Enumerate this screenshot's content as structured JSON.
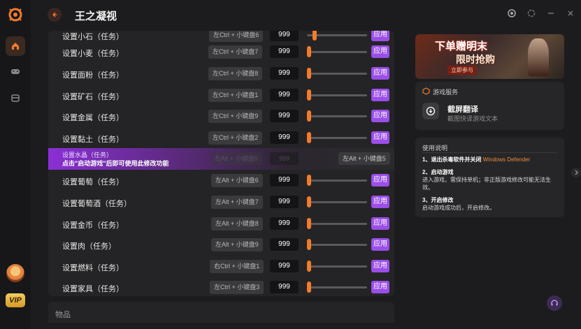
{
  "app": {
    "title": "王之凝视"
  },
  "rail": {
    "vip_label": "VIP"
  },
  "rows_cut": [
    {
      "label": "设置小石（任务）",
      "hotkey": "左Ctrl + 小键盘6",
      "value": "999",
      "apply": "应用"
    }
  ],
  "rows_top": [
    {
      "label": "设置小麦（任务）",
      "hotkey": "左Ctrl + 小键盘7",
      "value": "999",
      "apply": "应用"
    },
    {
      "label": "设置面粉（任务）",
      "hotkey": "左Ctrl + 小键盘8",
      "value": "999",
      "apply": "应用"
    },
    {
      "label": "设置矿石（任务）",
      "hotkey": "左Ctrl + 小键盘1",
      "value": "999",
      "apply": "应用"
    },
    {
      "label": "设置金属（任务）",
      "hotkey": "左Ctrl + 小键盘9",
      "value": "999",
      "apply": "应用"
    },
    {
      "label": "设置黏土（任务）",
      "hotkey": "左Ctrl + 小键盘2",
      "value": "999",
      "apply": "应用"
    }
  ],
  "banner": {
    "title": "设置水晶（任务）",
    "message": "点击\"启动游戏\"后即可使用此修改功能",
    "hotkey_faded": "左Alt + 小键盘5",
    "value_faded": "999",
    "hotkey_active": "左Alt + 小键盘5"
  },
  "rows_bottom": [
    {
      "label": "设置葡萄（任务）",
      "hotkey": "左Alt + 小键盘6",
      "value": "999",
      "apply": "应用"
    },
    {
      "label": "设置葡萄酒（任务）",
      "hotkey": "左Alt + 小键盘7",
      "value": "999",
      "apply": "应用"
    },
    {
      "label": "设置金币（任务）",
      "hotkey": "左Alt + 小键盘8",
      "value": "999",
      "apply": "应用"
    },
    {
      "label": "设置肉（任务）",
      "hotkey": "左Alt + 小键盘9",
      "value": "999",
      "apply": "应用"
    },
    {
      "label": "设置燃料（任务）",
      "hotkey": "右Ctrl + 小键盘1",
      "value": "999",
      "apply": "应用"
    },
    {
      "label": "设置家具（任务）",
      "hotkey": "左Ctrl + 小键盘3",
      "value": "999",
      "apply": "应用"
    }
  ],
  "collapsed_section": {
    "label": "物品"
  },
  "ad": {
    "main": "下单赠明末",
    "sub": "限时抢购",
    "tag": "立即参与"
  },
  "service": {
    "header": "游戏服务",
    "title": "截屏翻译",
    "desc": "截图快译游戏文本"
  },
  "help": {
    "title": "使用说明",
    "step1_title": "1、退出杀毒软件并关闭",
    "step1_highlight": "Windows Defender",
    "step2_title": "2、启动游戏",
    "step2_text": "进入游戏，需保持单机；非正版游戏修改可能无法生效。",
    "step3_title": "3、开启修改",
    "step3_text": "启动游戏成功后，开启修改。"
  },
  "colors": {
    "accent": "#f37b2c",
    "apply": "#9b4ee8",
    "banner": "#8b2fd6"
  }
}
